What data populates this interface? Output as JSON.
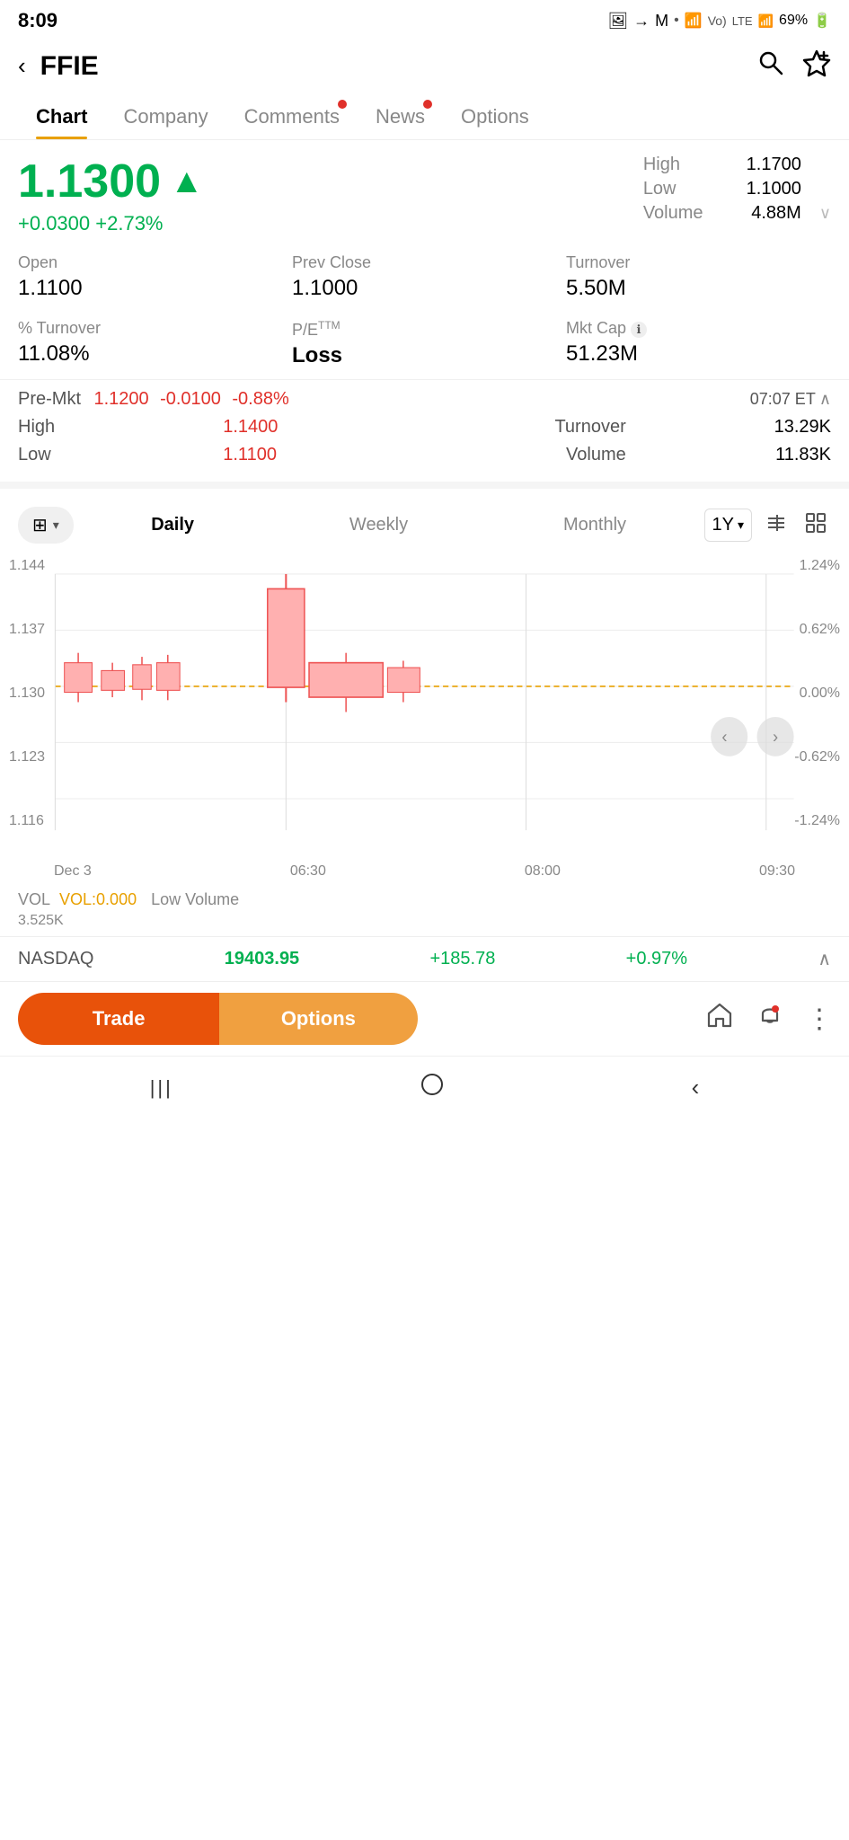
{
  "statusBar": {
    "time": "8:09",
    "battery": "69%",
    "signal": "WiFi + 4G"
  },
  "header": {
    "ticker": "FFIE",
    "backLabel": "←",
    "searchIcon": "🔍",
    "favoriteIcon": "🤍+"
  },
  "tabs": [
    {
      "id": "chart",
      "label": "Chart",
      "active": true,
      "dot": false
    },
    {
      "id": "company",
      "label": "Company",
      "active": false,
      "dot": false
    },
    {
      "id": "comments",
      "label": "Comments",
      "active": false,
      "dot": true
    },
    {
      "id": "news",
      "label": "News",
      "active": false,
      "dot": true
    },
    {
      "id": "options",
      "label": "Options",
      "active": false,
      "dot": false
    }
  ],
  "price": {
    "main": "1.1300",
    "arrowSymbol": "▲",
    "change": "+0.0300",
    "changePct": "+2.73%",
    "high": "1.1700",
    "low": "1.1000",
    "volume": "4.88M"
  },
  "infoGrid": {
    "open": {
      "label": "Open",
      "value": "1.1100"
    },
    "prevClose": {
      "label": "Prev Close",
      "value": "1.1000"
    },
    "turnover": {
      "label": "Turnover",
      "value": "5.50M"
    },
    "pctTurnover": {
      "label": "% Turnover",
      "value": "11.08%"
    },
    "pe": {
      "label": "P/EᴜM",
      "value": "Loss",
      "bold": true
    },
    "mktCap": {
      "label": "Mkt Cap",
      "value": "51.23M"
    }
  },
  "preMarket": {
    "label": "Pre-Mkt",
    "price": "1.1200",
    "change": "-0.0100",
    "changePct": "-0.88%",
    "time": "07:07 ET",
    "high": {
      "label": "High",
      "value": "1.1400"
    },
    "low": {
      "label": "Low",
      "value": "1.1100"
    },
    "turnover": {
      "label": "Turnover",
      "value": "13.29K"
    },
    "volume": {
      "label": "Volume",
      "value": "11.83K"
    }
  },
  "chartControls": {
    "typeIcon": "▦",
    "periods": [
      "Daily",
      "Weekly",
      "Monthly"
    ],
    "activePeriod": "Daily",
    "range": "1Y",
    "tools": [
      "⊕",
      "⊞"
    ]
  },
  "chartData": {
    "yLabelsLeft": [
      "1.144",
      "1.137",
      "1.130",
      "1.123",
      "1.116"
    ],
    "yLabelsRight": [
      "1.24%",
      "0.62%",
      "0.00%",
      "-0.62%",
      "-1.24%"
    ],
    "xLabels": [
      "Dec 3",
      "06:30",
      "08:00",
      "09:30"
    ],
    "baselineY": 0.5,
    "baselineDash": "1.130"
  },
  "volumeInfo": {
    "label": "VOL",
    "value": "VOL:0.000",
    "lowVolume": "Low Volume",
    "amount": "3.525K"
  },
  "nasdaq": {
    "name": "NASDAQ",
    "price": "19403.95",
    "change": "+185.78",
    "changePct": "+0.97%",
    "expandIcon": "∧"
  },
  "bottomNav": {
    "tradeLabel": "Trade",
    "optionsLabel": "Options",
    "homeIcon": "🏠",
    "bellIcon": "🔔",
    "menuIcon": "⋮"
  },
  "systemNav": {
    "menuIcon": "|||",
    "homeIcon": "○",
    "backIcon": "<"
  }
}
